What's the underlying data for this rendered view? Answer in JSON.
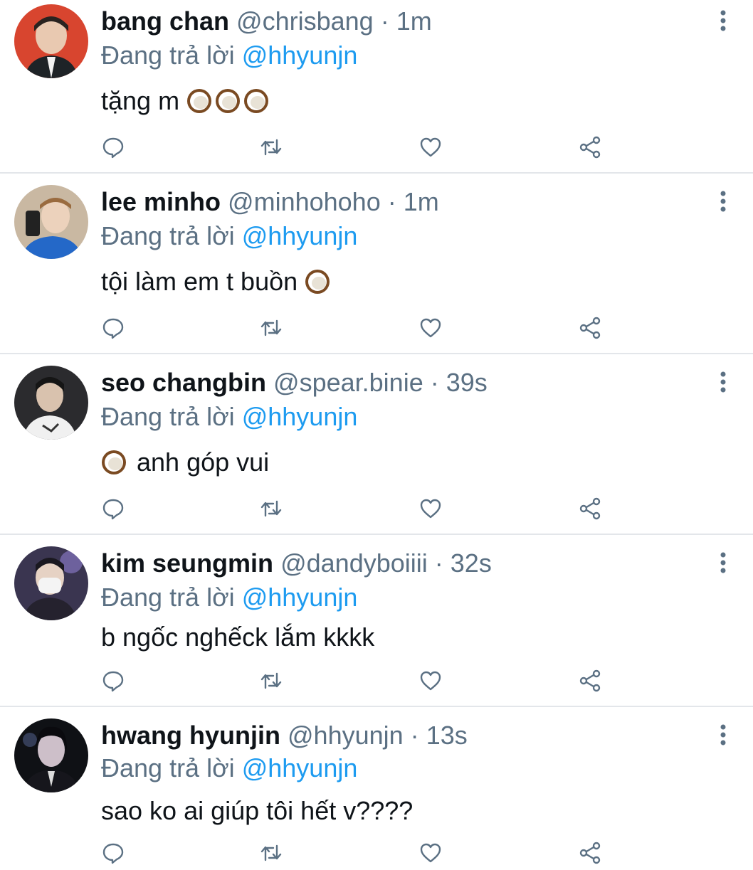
{
  "reply_prefix": "Đang trả lời",
  "separator": "·",
  "colors": {
    "link": "#1d9bf0",
    "muted": "#5b7083",
    "divider": "#e3e6ea"
  },
  "icons": {
    "reply": "reply-icon",
    "retweet": "retweet-icon",
    "like": "heart-icon",
    "share": "share-icon",
    "more": "more-vertical-icon",
    "emoji": "coconut-emoji"
  },
  "tweets": [
    {
      "name": "bang chan",
      "handle": "@chrisbang",
      "time": "1m",
      "reply_to": "@hhyunjn",
      "text": "tặng m",
      "emoji_count": 3,
      "emoji_position": "after"
    },
    {
      "name": "lee minho",
      "handle": "@minhohoho",
      "time": "1m",
      "reply_to": "@hhyunjn",
      "text": "tội làm em t buồn",
      "emoji_count": 1,
      "emoji_position": "after"
    },
    {
      "name": "seo changbin",
      "handle": "@spear.binie",
      "time": "39s",
      "reply_to": "@hhyunjn",
      "text": "anh góp vui",
      "emoji_count": 1,
      "emoji_position": "before"
    },
    {
      "name": "kim seungmin",
      "handle": "@dandyboiiii",
      "time": "32s",
      "reply_to": "@hhyunjn",
      "text": "b ngốc nghếck lắm kkkk",
      "emoji_count": 0,
      "emoji_position": "none"
    },
    {
      "name": "hwang hyunjin",
      "handle": "@hhyunjn",
      "time": "13s",
      "reply_to": "@hhyunjn",
      "text": "sao ko ai giúp tôi hết v????",
      "emoji_count": 0,
      "emoji_position": "none"
    }
  ]
}
